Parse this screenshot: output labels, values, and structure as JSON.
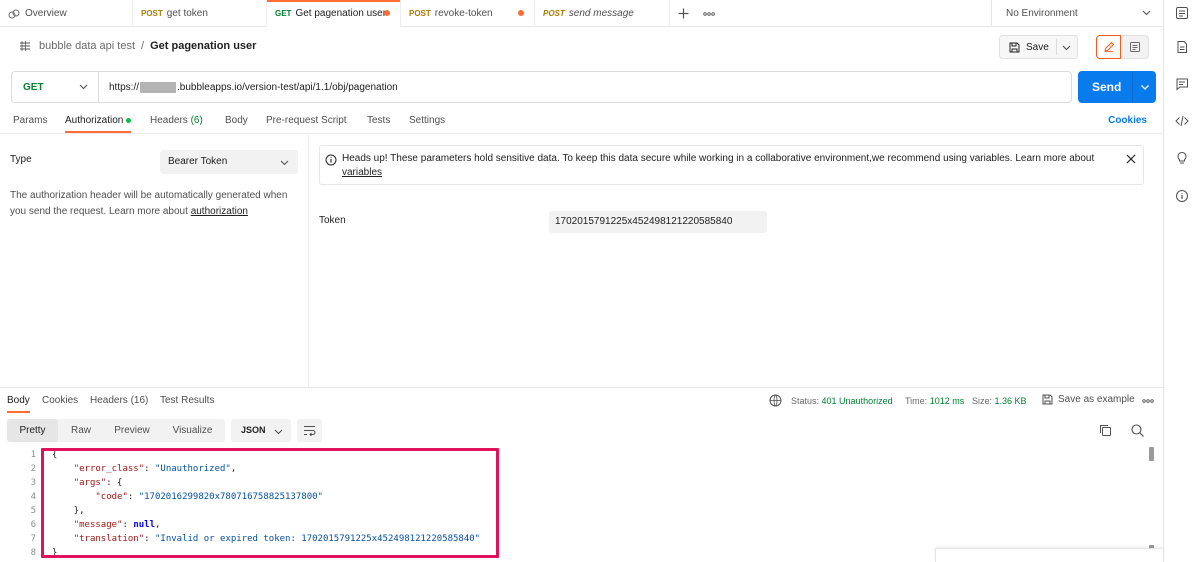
{
  "tabs": [
    {
      "method": "",
      "label": "Overview",
      "icon": "overview-icon",
      "dirty": false,
      "active": false
    },
    {
      "method": "POST",
      "label": "get token",
      "dirty": false,
      "active": false
    },
    {
      "method": "GET",
      "label": "Get pagenation user",
      "dirty": true,
      "active": true
    },
    {
      "method": "POST",
      "label": "revoke-token",
      "dirty": true,
      "active": false
    },
    {
      "method": "POST",
      "label": "send message",
      "dirty": false,
      "active": false
    }
  ],
  "environment": "No Environment",
  "breadcrumb": {
    "collection": "bubble data api test",
    "separator": "/",
    "request": "Get pagenation user"
  },
  "header": {
    "save_label": "Save"
  },
  "request": {
    "method": "GET",
    "url_prefix": "https://",
    "url_suffix": ".bubbleapps.io/version-test/api/1.1/obj/pagenation",
    "send_label": "Send"
  },
  "request_tabs": {
    "params": "Params",
    "authorization": "Authorization",
    "headers": "Headers",
    "headers_count": "(6)",
    "body": "Body",
    "prerequest": "Pre-request Script",
    "tests": "Tests",
    "settings": "Settings",
    "cookies": "Cookies"
  },
  "auth": {
    "type_label": "Type",
    "type_value": "Bearer Token",
    "description": "The authorization header will be automatically generated when you send the request. Learn more about ",
    "description_link": "authorization",
    "notice": "Heads up! These parameters hold sensitive data. To keep this data secure while working in a collaborative environment,we recommend using variables. Learn more about ",
    "notice_link": "variables",
    "token_label": "Token",
    "token_value": "1702015791225x452498121220585840"
  },
  "response_tabs": {
    "body": "Body",
    "cookies": "Cookies",
    "headers": "Headers (16)",
    "test_results": "Test Results"
  },
  "response_status": {
    "status_label": "Status:",
    "status_value": "401 Unauthorized",
    "time_label": "Time:",
    "time_value": "1012 ms",
    "size_label": "Size:",
    "size_value": "1.36 KB",
    "save_example": "Save as example"
  },
  "view_modes": [
    "Pretty",
    "Raw",
    "Preview",
    "Visualize"
  ],
  "format": "JSON",
  "code_lines": [
    {
      "n": "1",
      "text": "{"
    },
    {
      "n": "2",
      "key": "\"error_class\"",
      "sep": ": ",
      "val": "\"Unauthorized\"",
      "end": ",",
      "indent": "    "
    },
    {
      "n": "3",
      "key": "\"args\"",
      "sep": ": ",
      "val": "",
      "end": "{",
      "indent": "    "
    },
    {
      "n": "4",
      "key": "\"code\"",
      "sep": ": ",
      "val": "\"1702016299820x780716758825137800\"",
      "end": "",
      "indent": "        "
    },
    {
      "n": "5",
      "text": "    },"
    },
    {
      "n": "6",
      "key": "\"message\"",
      "sep": ": ",
      "kw": "null",
      "end": ",",
      "indent": "    "
    },
    {
      "n": "7",
      "key": "\"translation\"",
      "sep": ": ",
      "val": "\"Invalid or expired token: 1702015791225x452498121220585840\"",
      "end": "",
      "indent": "    "
    },
    {
      "n": "8",
      "text": "}"
    }
  ]
}
